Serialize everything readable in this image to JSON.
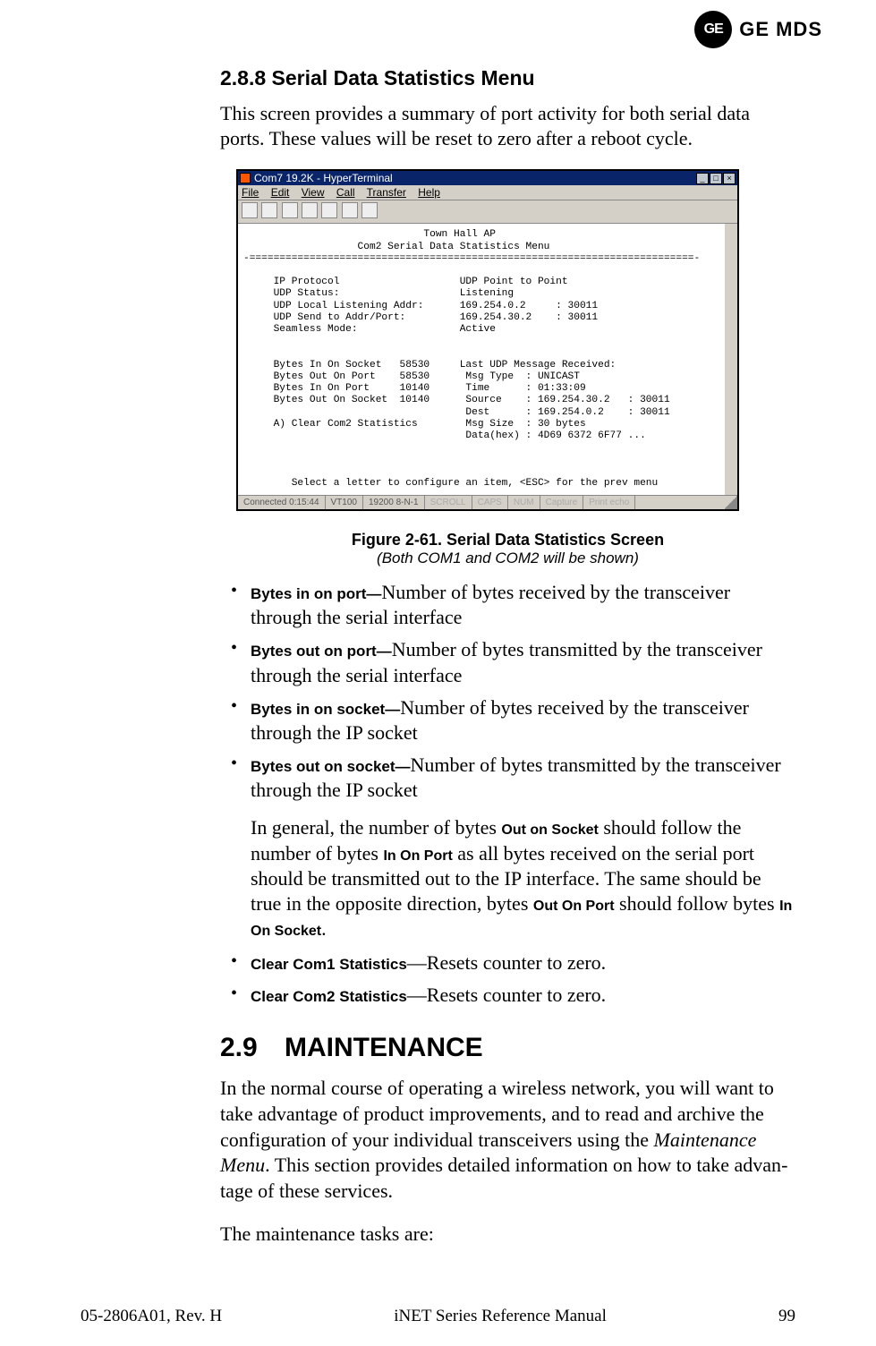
{
  "logo": {
    "monogram": "GE",
    "brand": "GE MDS"
  },
  "section_heading": "2.8.8 Serial Data Statistics Menu",
  "intro": "This screen provides a summary of port activity for both serial data ports. These values will be reset to zero after a reboot cycle.",
  "terminal": {
    "title": "Com7 19.2K - HyperTerminal",
    "menus": {
      "file": "File",
      "edit": "Edit",
      "view": "View",
      "call": "Call",
      "transfer": "Transfer",
      "help": "Help"
    },
    "wbtns": {
      "min": "_",
      "max": "□",
      "close": "×"
    },
    "status": {
      "conn": "Connected 0:15:44",
      "emul": "VT100",
      "baud": "19200 8-N-1",
      "scroll": "SCROLL",
      "caps": "CAPS",
      "num": "NUM",
      "capture": "Capture",
      "print": "Print echo"
    },
    "text_lines": [
      "                              Town Hall AP",
      "                   Com2 Serial Data Statistics Menu",
      "-==========================================================================-",
      "",
      "     IP Protocol                    UDP Point to Point",
      "     UDP Status:                    Listening",
      "     UDP Local Listening Addr:      169.254.0.2     : 30011",
      "     UDP Send to Addr/Port:         169.254.30.2    : 30011",
      "     Seamless Mode:                 Active",
      "",
      "",
      "     Bytes In On Socket   58530     Last UDP Message Received:",
      "     Bytes Out On Port    58530      Msg Type  : UNICAST",
      "     Bytes In On Port     10140      Time      : 01:33:09",
      "     Bytes Out On Socket  10140      Source    : 169.254.30.2   : 30011",
      "                                     Dest      : 169.254.0.2    : 30011",
      "     A) Clear Com2 Statistics        Msg Size  : 30 bytes",
      "                                     Data(hex) : 4D69 6372 6F77 ...",
      "",
      "",
      "",
      "        Select a letter to configure an item, <ESC> for the prev menu"
    ]
  },
  "figure": {
    "caption": "Figure 2-61. Serial Data Statistics Screen",
    "subcaption": "(Both COM1 and COM2 will be shown)"
  },
  "bullets": {
    "b1_label": "Bytes in on port—",
    "b1_text": "Number of bytes received by the transceiver through the serial interface",
    "b2_label": "Bytes out on port—",
    "b2_text": "Number of bytes transmitted by the trans­ceiver through the serial interface",
    "b3_label": "Bytes in on socket—",
    "b3_text": "Number of bytes received by the trans­ceiver through the IP socket",
    "b4_label": "Bytes out on socket—",
    "b4_text": "Number of bytes transmitted by the trans­ceiver through the IP socket"
  },
  "followup": {
    "p1a": "In general, the number of bytes ",
    "oos": "Out on Socket",
    "p1b": " should follow the number of bytes ",
    "iop": "In On Port",
    "p1c": " as all bytes received on the serial port should be transmitted out to the IP interface. The same should be true in the opposite direction, bytes ",
    "oop": "Out On Port",
    "p1d": " should follow bytes ",
    "ios": "In On Socket",
    "p1e": "."
  },
  "clear": {
    "c1_label": "Clear Com1 Statistics",
    "c1_text": "—Resets counter to zero.",
    "c2_label": "Clear Com2 Statistics",
    "c2_text": "—Resets counter to zero."
  },
  "maint": {
    "num": "2.9",
    "title": "MAINTENANCE",
    "body_a": "In the normal course of operating a wireless network, you will want to take advantage of product improvements, and to read and archive the configuration of your individual transceivers using the ",
    "body_italic": "Maintenance Menu",
    "body_b": ". This section provides detailed information on how to take advan­tage of these services.",
    "tasks_lead": "The maintenance tasks are:"
  },
  "footer": {
    "left": "05-2806A01, Rev. H",
    "center": "iNET Series Reference Manual",
    "right": "99"
  }
}
